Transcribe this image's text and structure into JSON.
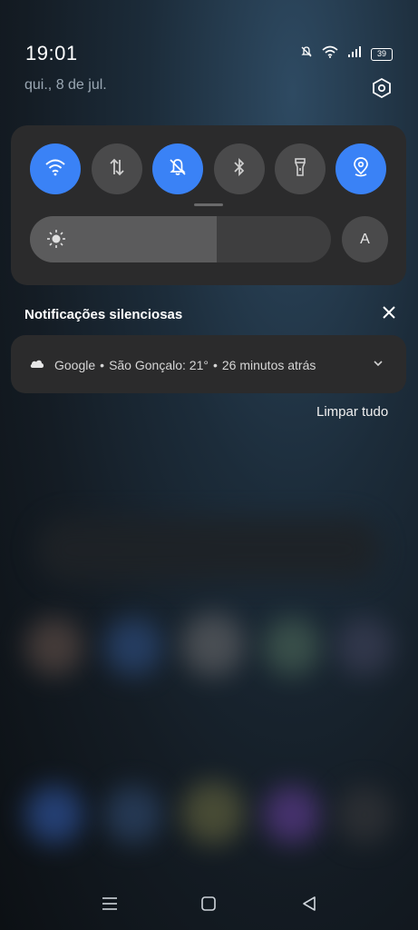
{
  "status_bar": {
    "time": "19:01",
    "battery": "39",
    "icons": [
      "mute-bell-icon",
      "wifi-icon",
      "signal-icon",
      "battery-icon"
    ]
  },
  "header": {
    "date": "qui., 8 de jul.",
    "settings_icon": "settings-hexagon-icon"
  },
  "quick_settings": {
    "tiles": [
      {
        "name": "wifi",
        "icon": "wifi-icon",
        "active": true
      },
      {
        "name": "mobile-data",
        "icon": "data-arrows-icon",
        "active": false
      },
      {
        "name": "silent-mode",
        "icon": "bell-off-icon",
        "active": true
      },
      {
        "name": "bluetooth",
        "icon": "bluetooth-icon",
        "active": false
      },
      {
        "name": "flashlight",
        "icon": "flashlight-icon",
        "active": false
      },
      {
        "name": "location",
        "icon": "location-pin-icon",
        "active": true
      }
    ],
    "brightness_level": 0.62,
    "auto_brightness_label": "A",
    "accent_color": "#3a82f6"
  },
  "notifications": {
    "section_title": "Notificações silenciosas",
    "items": [
      {
        "app": "Google",
        "content": "São Gonçalo: 21°",
        "time": "26 minutos atrás",
        "icon": "cloud-icon"
      }
    ],
    "clear_all_label": "Limpar tudo"
  },
  "nav_bar": {
    "buttons": [
      "menu-icon",
      "home-icon",
      "back-icon"
    ]
  }
}
